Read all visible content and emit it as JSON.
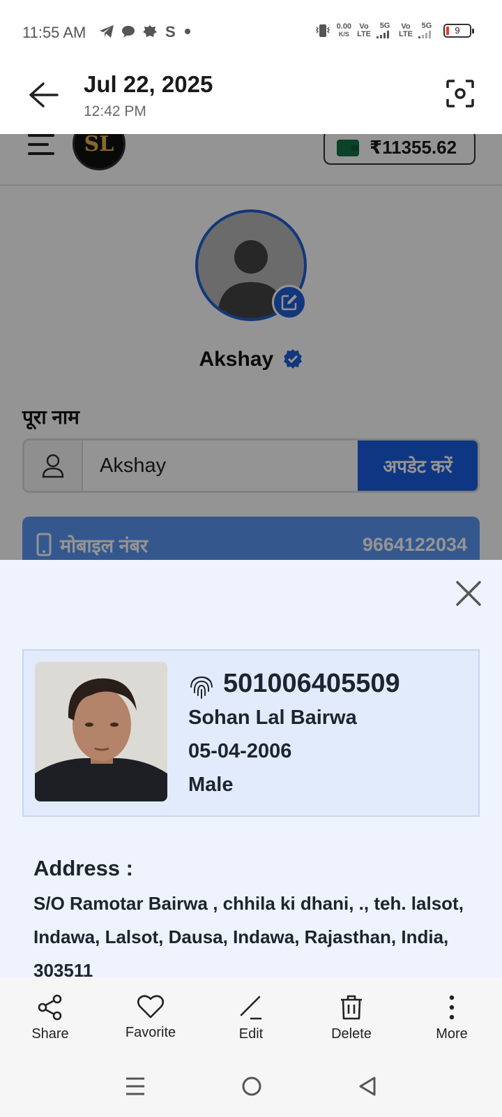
{
  "status_bar": {
    "time": "11:55 AM",
    "net_speed_top": "0.00",
    "net_speed_unit": "K/S",
    "sim1_volte_top": "Vo",
    "sim1_volte_bottom": "LTE",
    "sim1_network": "5G",
    "sim2_volte_top": "Vo",
    "sim2_volte_bottom": "LTE",
    "sim2_network": "5G",
    "battery": "9"
  },
  "viewer_header": {
    "date": "Jul 22, 2025",
    "time": "12:42 PM"
  },
  "app": {
    "logo_text": "SL",
    "wallet_amount": "₹11355.62",
    "user_name": "Akshay",
    "full_name_label": "पूरा नाम",
    "full_name_value": "Akshay",
    "update_button": "अपडेट करें",
    "mobile_label": "मोबाइल नंबर",
    "mobile_value": "9664122034",
    "accent_color": "#1a5ee0"
  },
  "sheet": {
    "aadhaar_number": "501006405509",
    "name": "Sohan Lal Bairwa",
    "dob": "05-04-2006",
    "gender": "Male",
    "address_heading": "Address :",
    "address": "S/O Ramotar Bairwa , chhila ki dhani, ., teh. lalsot, Indawa, Lalsot, Dausa, Indawa, Rajasthan, India, 303511"
  },
  "actions": [
    {
      "label": "Share",
      "icon": "share-icon"
    },
    {
      "label": "Favorite",
      "icon": "heart-icon"
    },
    {
      "label": "Edit",
      "icon": "pencil-icon"
    },
    {
      "label": "Delete",
      "icon": "trash-icon"
    },
    {
      "label": "More",
      "icon": "more-vertical-icon"
    }
  ]
}
